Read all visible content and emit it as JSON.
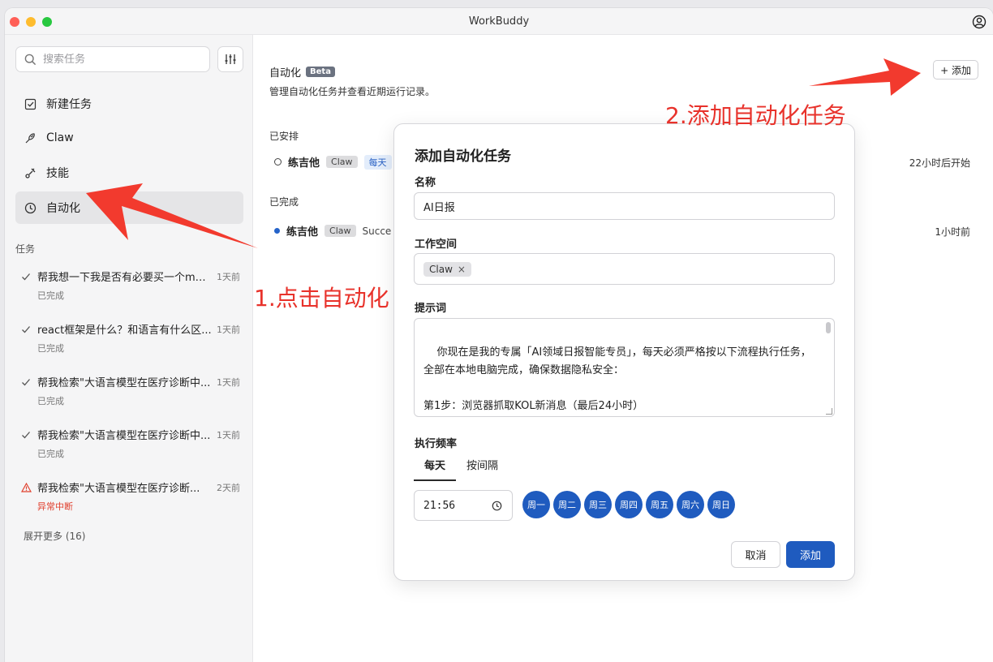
{
  "window": {
    "title": "WorkBuddy"
  },
  "sidebar": {
    "search_placeholder": "搜索任务",
    "nav": [
      {
        "label": "新建任务",
        "icon": "new-task-icon"
      },
      {
        "label": "Claw",
        "icon": "claw-icon"
      },
      {
        "label": "技能",
        "icon": "skills-icon"
      },
      {
        "label": "自动化",
        "icon": "clock-icon"
      }
    ],
    "section_label": "任务",
    "tasks": [
      {
        "name": "帮我想一下我是否有必要买一个ma...",
        "time": "1天前",
        "status": "已完成",
        "state": "done"
      },
      {
        "name": "react框架是什么？和语言有什么区...",
        "time": "1天前",
        "status": "已完成",
        "state": "done"
      },
      {
        "name": "帮我检索\"大语言模型在医疗诊断中...",
        "time": "1天前",
        "status": "已完成",
        "state": "done"
      },
      {
        "name": "帮我检索\"大语言模型在医疗诊断中...",
        "time": "1天前",
        "status": "已完成",
        "state": "done"
      },
      {
        "name": "帮我检索\"大语言模型在医疗诊断...",
        "time": "2天前",
        "status": "异常中断",
        "state": "error"
      }
    ],
    "more": "展开更多 (16)"
  },
  "main": {
    "title": "自动化",
    "beta": "Beta",
    "subtitle": "管理自动化任务并查看近期运行记录。",
    "add_button": "+ 添加",
    "scheduled_label": "已安排",
    "scheduled": {
      "name": "练吉他",
      "tag": "Claw",
      "freq": "每天",
      "time": "22小时后开始"
    },
    "completed_label": "已完成",
    "completed": {
      "name": "练吉他",
      "tag": "Claw",
      "result": "Succe",
      "time": "1小时前"
    }
  },
  "annotations": {
    "step1": "1.点击自动化",
    "step2": "2.添加自动化任务"
  },
  "modal": {
    "title": "添加自动化任务",
    "name_label": "名称",
    "name_value": "AI日报",
    "workspace_label": "工作空间",
    "workspace_chip": "Claw",
    "prompt_label": "提示词",
    "prompt_text": "你现在是我的专属「AI领域日报智能专员」，每天必须严格按以下流程执行任务，全部在本地电脑完成，确保数据隐私安全：\n\n第1步：浏览器抓取KOL新消息（最后24小时）\n- 打开 Chrome 浏览器\n- 逐一访问以下KOL/媒体账号页面：",
    "freq_label": "执行频率",
    "tabs": [
      "每天",
      "按间隔"
    ],
    "time_value": "21:56",
    "days": [
      "周一",
      "周二",
      "周三",
      "周四",
      "周五",
      "周六",
      "周日"
    ],
    "cancel": "取消",
    "submit": "添加"
  },
  "colors": {
    "accent": "#1f5bbf",
    "annotation": "#e8322b",
    "error": "#e0402e"
  }
}
